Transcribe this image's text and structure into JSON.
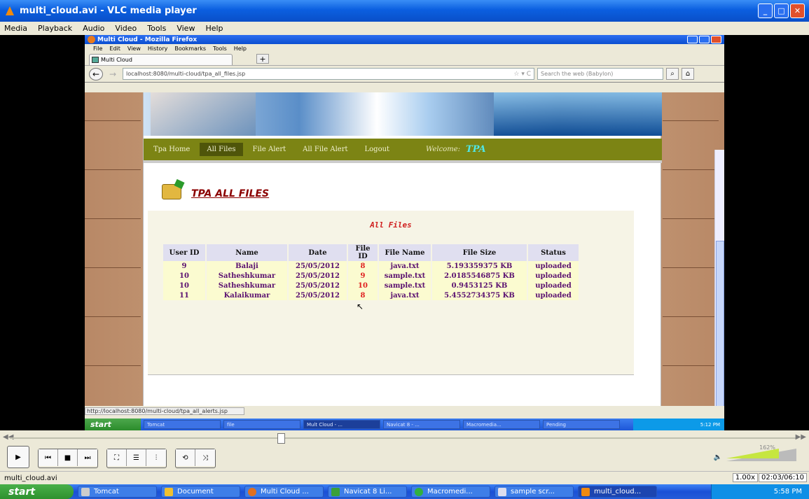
{
  "vlc": {
    "title": "multi_cloud.avi - VLC media player",
    "menu": [
      "Media",
      "Playback",
      "Audio",
      "Video",
      "Tools",
      "View",
      "Help"
    ],
    "status_file": "multi_cloud.avi",
    "rate": "1.00x",
    "time": "02:03/06:10",
    "volume": "162%"
  },
  "firefox": {
    "title": "Multi Cloud - Mozilla Firefox",
    "menu": [
      "File",
      "Edit",
      "View",
      "History",
      "Bookmarks",
      "Tools",
      "Help"
    ],
    "tab_label": "Multi Cloud",
    "url": "localhost:8080/multi-cloud/tpa_all_files.jsp",
    "search_placeholder": "Search the web (Babylon)",
    "status_url": "http://localhost:8080/multi-cloud/tpa_all_alerts.jsp"
  },
  "site": {
    "nav": [
      "Tpa Home",
      "All Files",
      "File Alert",
      "All File Alert",
      "Logout"
    ],
    "welcome": "Welcome:",
    "user": "TPA",
    "heading": "TPA ALL FILES",
    "panel_title": "All Files",
    "columns": [
      "User ID",
      "Name",
      "Date",
      "File ID",
      "File Name",
      "File Size",
      "Status"
    ],
    "rows": [
      [
        "9",
        "Balaji",
        "25/05/2012",
        "8",
        "java.txt",
        "5.193359375 KB",
        "uploaded"
      ],
      [
        "10",
        "Satheshkumar",
        "25/05/2012",
        "9",
        "sample.txt",
        "2.0185546875 KB",
        "uploaded"
      ],
      [
        "10",
        "Satheshkumar",
        "25/05/2012",
        "10",
        "sample.txt",
        "0.9453125 KB",
        "uploaded"
      ],
      [
        "11",
        "Kalaikumar",
        "25/05/2012",
        "8",
        "java.txt",
        "5.4552734375 KB",
        "uploaded"
      ]
    ]
  },
  "inner_taskbar": {
    "start": "start",
    "items": [
      "Tomcat",
      "file",
      "Mult Cloud - ...",
      "Navicat 8 - ...",
      "Macromedia...",
      "Pending"
    ],
    "clock": "5:12 PM"
  },
  "taskbar": {
    "start": "start",
    "items": [
      "Tomcat",
      "Document",
      "Multi Cloud ...",
      "Navicat 8 Li...",
      "Macromedi...",
      "sample scr...",
      "multi_cloud..."
    ],
    "clock": "5:58 PM"
  }
}
